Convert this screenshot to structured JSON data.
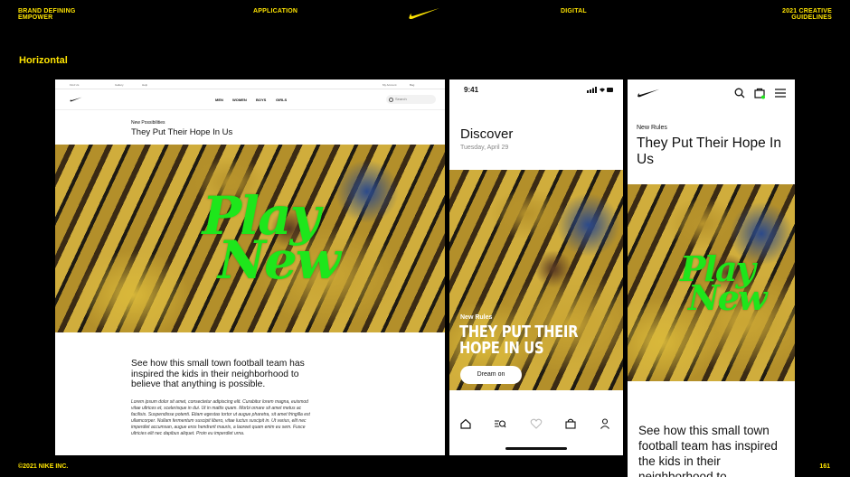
{
  "header": {
    "left_line1": "BRAND DEFINING",
    "left_line2": "EMPOWER",
    "center_left": "APPLICATION",
    "center_right": "DIGITAL",
    "right_line1": "2021 CREATIVE",
    "right_line2": "GUIDELINES",
    "swoosh_color": "#fde302"
  },
  "section_label": "Horizontal",
  "footer": {
    "copyright": "©2021 NIKE INC.",
    "page_number": "161"
  },
  "desktop": {
    "util_links": [
      "Find Us",
      "Gallery",
      "Help",
      "My Account",
      "Bag"
    ],
    "nav_items": [
      "MEN",
      "WOMEN",
      "BOYS",
      "GIRLS"
    ],
    "search_placeholder": "Search",
    "eyebrow": "New Possibilities",
    "title": "They Put Their Hope In Us",
    "overlay_line1": "Play",
    "overlay_line2": "New",
    "headline": "See how this small town football team has inspired the kids in their neighborhood to believe that anything is possible.",
    "body": "Lorem ipsum dolor sit amet, consectetur adipiscing elit. Curabitur lorem magna, euismod vitae ultrices et, scelerisque in dui. Ut in mattis quam. Morbi ornare sit amet metus ac facilisis. Suspendisse potenti. Etiam egestas tortor ut augue pharetra, sit amet fringilla est ullamcorper. Nullam fermentum suscipit libero, vitae luctus suscipit in. Ut varius, elit nec imperdiet accumsan, augue eros hendrerit mauris, a laoreet quam enim eu sem. Fusce ultricies elit nec dapibus aliquet. Proin eu imperdiet urna."
  },
  "phone_app": {
    "time": "9:41",
    "screen_title": "Discover",
    "date": "Tuesday, April 29",
    "card_eyebrow": "New Rules",
    "card_title_line1": "THEY PUT THEIR",
    "card_title_line2": "HOPE IN US",
    "cta": "Dream on",
    "tabs": [
      "home-icon",
      "search-icon",
      "heart-icon",
      "bag-icon",
      "profile-icon"
    ]
  },
  "mobile_web": {
    "icons": [
      "search-icon",
      "bag-icon",
      "menu-icon"
    ],
    "eyebrow": "New Rules",
    "title": "They Put Their Hope In Us",
    "overlay_line1": "Play",
    "overlay_line2": "New",
    "headline": "See how this small town football team has inspired the kids in their neighborhood to"
  }
}
